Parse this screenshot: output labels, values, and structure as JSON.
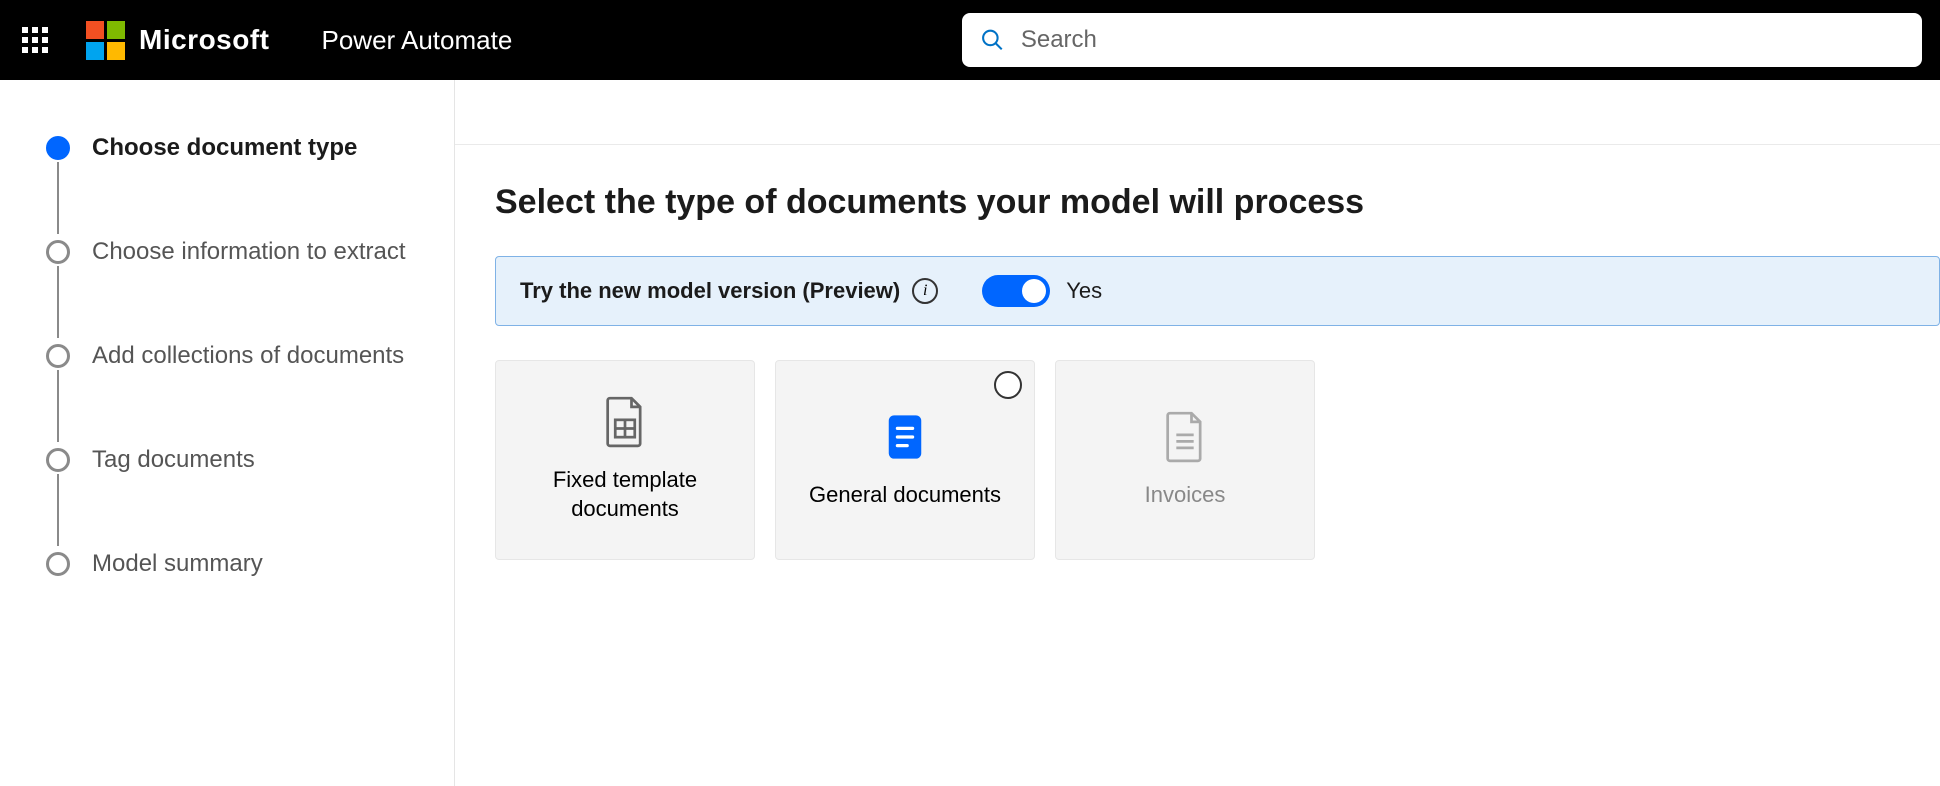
{
  "header": {
    "brand": "Microsoft",
    "product": "Power Automate",
    "search_placeholder": "Search"
  },
  "steps": [
    {
      "label": "Choose document type",
      "active": true
    },
    {
      "label": "Choose information to extract",
      "active": false
    },
    {
      "label": "Add collections of documents",
      "active": false
    },
    {
      "label": "Tag documents",
      "active": false
    },
    {
      "label": "Model summary",
      "active": false
    }
  ],
  "page": {
    "title": "Select the type of documents your model will process"
  },
  "banner": {
    "text": "Try the new model version (Preview)",
    "toggle_label": "Yes",
    "toggle_on": true
  },
  "cards": [
    {
      "label": "Fixed template documents",
      "icon": "fixed",
      "radio": false,
      "muted": false
    },
    {
      "label": "General documents",
      "icon": "general",
      "radio": true,
      "muted": false
    },
    {
      "label": "Invoices",
      "icon": "invoice",
      "radio": false,
      "muted": true
    }
  ]
}
